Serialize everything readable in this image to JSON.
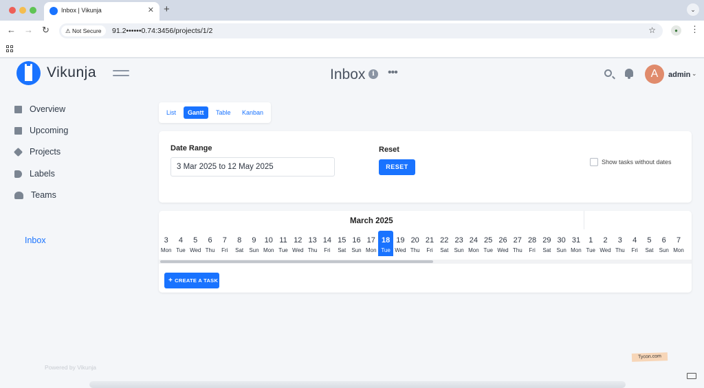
{
  "browser": {
    "tab_title": "Inbox | Vikunja",
    "tab_close": "✕",
    "new_tab": "+",
    "not_secure_label": "Not Secure",
    "url": "91.2••••••0.74:3456/projects/1/2"
  },
  "app": {
    "logo_text": "Vikunja",
    "page_title": "Inbox",
    "user": {
      "avatar_letter": "A",
      "name": "admin"
    }
  },
  "sidebar": {
    "items": [
      {
        "label": "Overview",
        "icon": "calendar-icon"
      },
      {
        "label": "Upcoming",
        "icon": "calendar-icon"
      },
      {
        "label": "Projects",
        "icon": "layers-icon"
      },
      {
        "label": "Labels",
        "icon": "tag-icon"
      },
      {
        "label": "Teams",
        "icon": "users-icon"
      }
    ],
    "project": "Inbox",
    "powered_by": "Powered by Vikunja"
  },
  "views": {
    "tabs": [
      {
        "label": "List",
        "active": false
      },
      {
        "label": "Gantt",
        "active": true
      },
      {
        "label": "Table",
        "active": false
      },
      {
        "label": "Kanban",
        "active": false
      }
    ]
  },
  "filters": {
    "date_range_label": "Date Range",
    "date_range_value": "3 Mar 2025 to 12 May 2025",
    "reset_label": "Reset",
    "reset_button": "RESET",
    "show_without_dates": "Show tasks without dates"
  },
  "gantt": {
    "month": "March 2025",
    "days": [
      {
        "n": "3",
        "d": "Mon"
      },
      {
        "n": "4",
        "d": "Tue"
      },
      {
        "n": "5",
        "d": "Wed"
      },
      {
        "n": "6",
        "d": "Thu"
      },
      {
        "n": "7",
        "d": "Fri"
      },
      {
        "n": "8",
        "d": "Sat"
      },
      {
        "n": "9",
        "d": "Sun"
      },
      {
        "n": "10",
        "d": "Mon"
      },
      {
        "n": "11",
        "d": "Tue"
      },
      {
        "n": "12",
        "d": "Wed"
      },
      {
        "n": "13",
        "d": "Thu"
      },
      {
        "n": "14",
        "d": "Fri"
      },
      {
        "n": "15",
        "d": "Sat"
      },
      {
        "n": "16",
        "d": "Sun"
      },
      {
        "n": "17",
        "d": "Mon"
      },
      {
        "n": "18",
        "d": "Tue",
        "today": true
      },
      {
        "n": "19",
        "d": "Wed"
      },
      {
        "n": "20",
        "d": "Thu"
      },
      {
        "n": "21",
        "d": "Fri"
      },
      {
        "n": "22",
        "d": "Sat"
      },
      {
        "n": "23",
        "d": "Sun"
      },
      {
        "n": "24",
        "d": "Mon"
      },
      {
        "n": "25",
        "d": "Tue"
      },
      {
        "n": "26",
        "d": "Wed"
      },
      {
        "n": "27",
        "d": "Thu"
      },
      {
        "n": "28",
        "d": "Fri"
      },
      {
        "n": "29",
        "d": "Sat"
      },
      {
        "n": "30",
        "d": "Sun"
      },
      {
        "n": "31",
        "d": "Mon"
      },
      {
        "n": "1",
        "d": "Tue"
      },
      {
        "n": "2",
        "d": "Wed"
      },
      {
        "n": "3",
        "d": "Thu"
      },
      {
        "n": "4",
        "d": "Fri"
      },
      {
        "n": "5",
        "d": "Sat"
      },
      {
        "n": "6",
        "d": "Sun"
      },
      {
        "n": "7",
        "d": "Mon"
      }
    ],
    "create_task": "CREATE A TASK"
  },
  "watermark": "Tycon.com",
  "colors": {
    "primary": "#1973ff",
    "avatar": "#e08b6c"
  }
}
